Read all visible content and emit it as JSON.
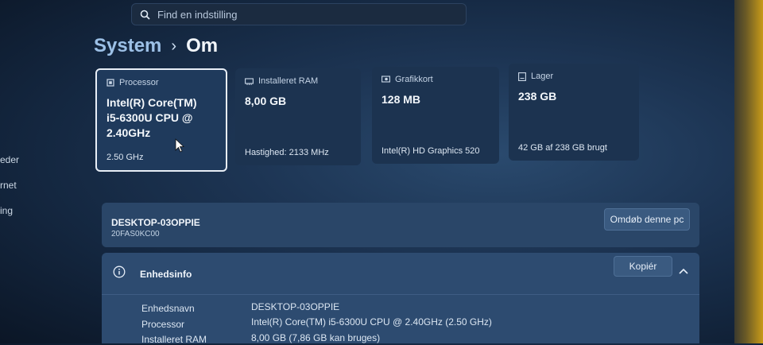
{
  "search": {
    "placeholder": "Find en indstilling"
  },
  "sidebar": {
    "items": [
      {
        "label": "eder"
      },
      {
        "label": "rnet"
      },
      {
        "label": "ing"
      }
    ]
  },
  "breadcrumb": {
    "parent": "System",
    "separator": "›",
    "current": "Om"
  },
  "cards": [
    {
      "title": "Processor",
      "value_lines": [
        "Intel(R) Core(TM)",
        "i5-6300U CPU @",
        "2.40GHz"
      ],
      "sub": "2.50 GHz",
      "icon": "processor-icon"
    },
    {
      "title": "Installeret RAM",
      "value_lines": [
        "8,00 GB"
      ],
      "sub": "Hastighed: 2133 MHz",
      "icon": "ram-icon"
    },
    {
      "title": "Grafikkort",
      "value_lines": [
        "128 MB"
      ],
      "sub": "Intel(R) HD Graphics 520",
      "icon": "graphics-card-icon"
    },
    {
      "title": "Lager",
      "value_lines": [
        "238 GB"
      ],
      "sub": "42 GB af 238 GB brugt",
      "icon": "storage-icon"
    }
  ],
  "device": {
    "name": "DESKTOP-03OPPIE",
    "model": "20FAS0KC00",
    "rename_label": "Omdøb denne pc"
  },
  "device_info": {
    "title": "Enhedsinfo",
    "copy_label": "Kopiér",
    "rows": [
      {
        "label": "Enhedsnavn",
        "value": "DESKTOP-03OPPIE"
      },
      {
        "label": "Processor",
        "value": "Intel(R) Core(TM) i5-6300U CPU @ 2.40GHz (2.50 GHz)"
      },
      {
        "label": "Installeret RAM",
        "value": "8,00 GB (7,86 GB kan bruges)"
      }
    ]
  },
  "colors": {
    "accent_text": "#9cc0e6",
    "card_bg": "#1c3350",
    "panel_bg": "#2a4668"
  }
}
